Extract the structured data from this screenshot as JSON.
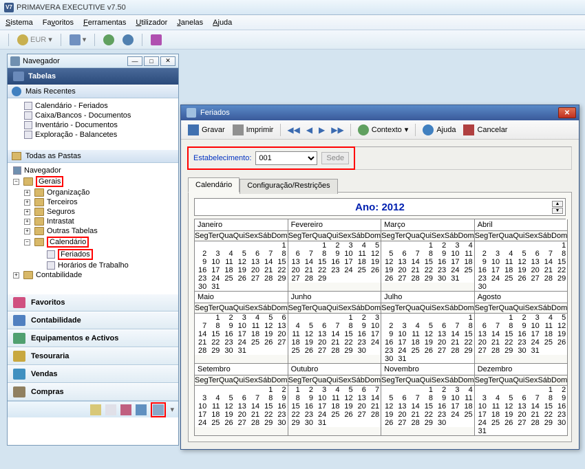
{
  "app": {
    "title": "PRIMAVERA EXECUTIVE v7.50",
    "icon_label": "V7"
  },
  "menu": [
    "Sistema",
    "Favoritos",
    "Ferramentas",
    "Utilizador",
    "Janelas",
    "Ajuda"
  ],
  "toolbar": {
    "currency": "EUR"
  },
  "navigator": {
    "panel_title": "Navegador",
    "header": "Tabelas",
    "section_recent": "Mais Recentes",
    "recent": [
      "Calendário - Feriados",
      "Caixa/Bancos - Documentos",
      "Inventário - Documentos",
      "Exploração - Balancetes"
    ],
    "section_all": "Todas as Pastas",
    "tree": {
      "root": "Navegador",
      "gerais": "Gerais",
      "gerais_children": [
        "Organização",
        "Terceiros",
        "Seguros",
        "Intrastat",
        "Outras Tabelas"
      ],
      "calendario": "Calendário",
      "feriados": "Feriados",
      "horarios": "Horários de Trabalho",
      "contabilidade": "Contabilidade"
    },
    "shortcuts": [
      {
        "label": "Favoritos",
        "color": "#d05080"
      },
      {
        "label": "Contabilidade",
        "color": "#5080c0"
      },
      {
        "label": "Equipamentos e Activos",
        "color": "#50a070"
      },
      {
        "label": "Tesouraria",
        "color": "#c8a840"
      },
      {
        "label": "Vendas",
        "color": "#4090c0"
      },
      {
        "label": "Compras",
        "color": "#908060"
      }
    ]
  },
  "dialog": {
    "title": "Feriados",
    "toolbar": {
      "gravar": "Gravar",
      "imprimir": "Imprimir",
      "contexto": "Contexto",
      "ajuda": "Ajuda",
      "cancelar": "Cancelar"
    },
    "filter": {
      "label": "Estabelecimento:",
      "value": "001",
      "desc": "Sede"
    },
    "tabs": [
      "Calendário",
      "Configuração/Restrições"
    ],
    "year_label": "Ano: 2012",
    "weekdays": [
      "Seg",
      "Ter",
      "Qua",
      "Qui",
      "Sex",
      "Sáb",
      "Dom"
    ],
    "months": [
      {
        "name": "Janeiro",
        "start": 6,
        "days": 31
      },
      {
        "name": "Fevereiro",
        "start": 2,
        "days": 29
      },
      {
        "name": "Março",
        "start": 3,
        "days": 31
      },
      {
        "name": "Abril",
        "start": 6,
        "days": 30
      },
      {
        "name": "Maio",
        "start": 1,
        "days": 31
      },
      {
        "name": "Junho",
        "start": 4,
        "days": 30
      },
      {
        "name": "Julho",
        "start": 6,
        "days": 31
      },
      {
        "name": "Agosto",
        "start": 2,
        "days": 31
      },
      {
        "name": "Setembro",
        "start": 5,
        "days": 30
      },
      {
        "name": "Outubro",
        "start": 0,
        "days": 31
      },
      {
        "name": "Novembro",
        "start": 3,
        "days": 30
      },
      {
        "name": "Dezembro",
        "start": 5,
        "days": 31
      }
    ]
  }
}
